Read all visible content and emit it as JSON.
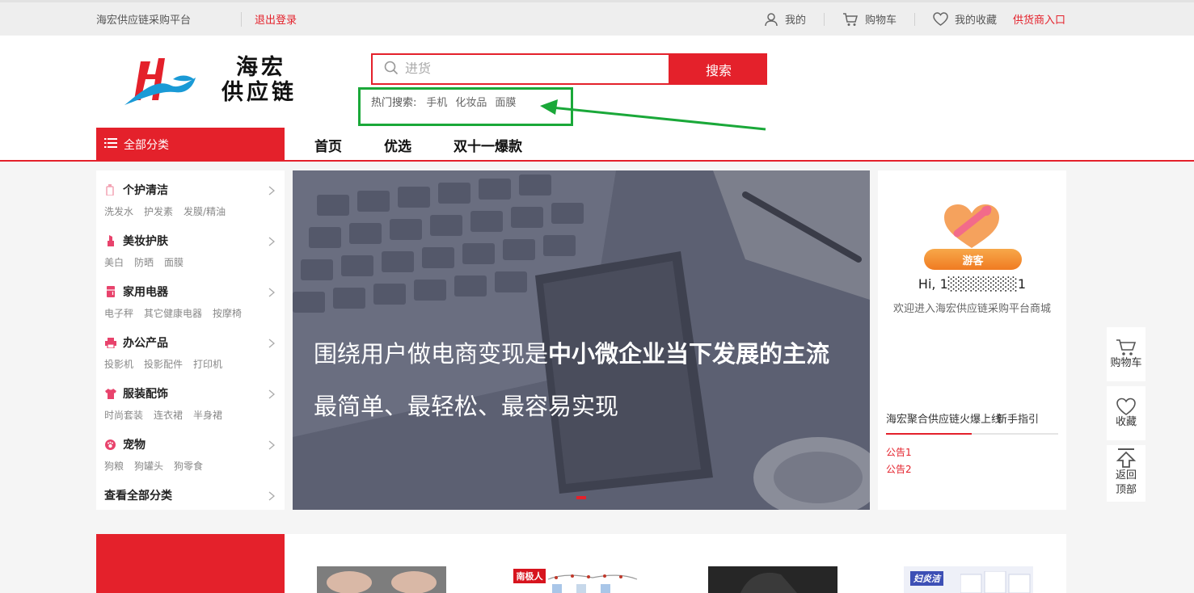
{
  "topbar": {
    "site_name": "海宏供应链采购平台",
    "logout": "退出登录",
    "my_account": "我的",
    "cart": "购物车",
    "favorites": "我的收藏",
    "supplier_entry": "供货商入口"
  },
  "logo": {
    "line1": "海宏",
    "line2": "供应链"
  },
  "search": {
    "placeholder": "进货",
    "button": "搜索",
    "hot_label": "热门搜索:",
    "hot_terms": [
      "手机",
      "化妆品",
      "面膜"
    ]
  },
  "nav": {
    "all_categories": "全部分类",
    "items": [
      "首页",
      "优选",
      "双十一爆款"
    ]
  },
  "categories": [
    {
      "name": "个护清洁",
      "icon": "bottle-icon",
      "subs": [
        "洗发水",
        "护发素",
        "发膜/精油"
      ]
    },
    {
      "name": "美妆护肤",
      "icon": "lipstick-icon",
      "subs": [
        "美白",
        "防晒",
        "面膜"
      ]
    },
    {
      "name": "家用电器",
      "icon": "fridge-icon",
      "subs": [
        "电子秤",
        "其它健康电器",
        "按摩椅"
      ]
    },
    {
      "name": "办公产品",
      "icon": "printer-icon",
      "subs": [
        "投影机",
        "投影配件",
        "打印机"
      ]
    },
    {
      "name": "服装配饰",
      "icon": "shirt-icon",
      "subs": [
        "时尚套装",
        "连衣裙",
        "半身裙"
      ]
    },
    {
      "name": "宠物",
      "icon": "paw-icon",
      "subs": [
        "狗粮",
        "狗罐头",
        "狗零食"
      ]
    }
  ],
  "view_all": "查看全部分类",
  "banner": {
    "line1_normal": "围绕用户做电商变现是",
    "line1_bold": "中小微企业当下发展的主流",
    "line2": "最简单、最轻松、最容易实现"
  },
  "user": {
    "role": "游客",
    "greeting": "Hi, 1░░░░░░░1",
    "welcome": "欢迎进入海宏供应链采购平台商城",
    "news_title": "海宏聚合供应链火爆上线",
    "news_overlay": "新手指引",
    "notices": [
      "公告1",
      "公告2"
    ]
  },
  "tools": {
    "cart": "购物车",
    "favorite": "收藏",
    "back_top_1": "返回",
    "back_top_2": "顶部"
  },
  "product_labels": [
    "南极人",
    "妇炎洁"
  ],
  "colors": {
    "brand_red": "#e4212b",
    "highlight_green": "#1aa839",
    "guest_orange": "#f07b22"
  }
}
